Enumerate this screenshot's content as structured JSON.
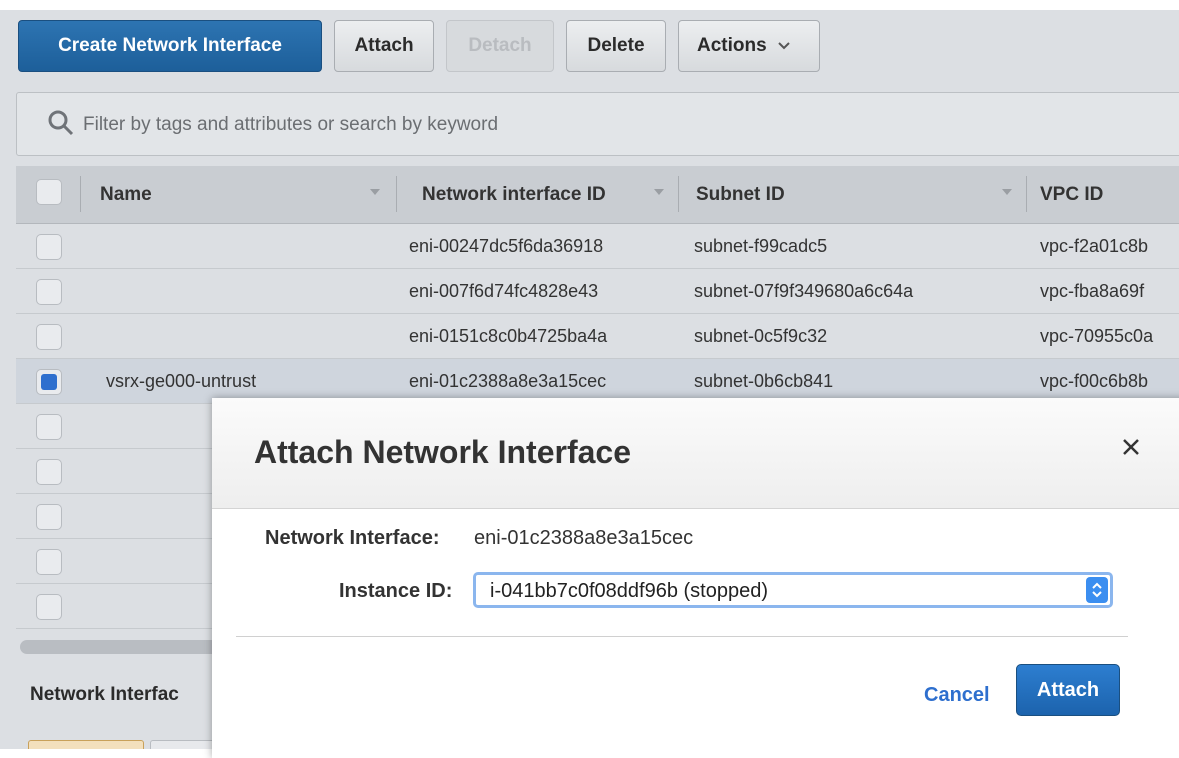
{
  "toolbar": {
    "create_label": "Create Network Interface",
    "attach_label": "Attach",
    "detach_label": "Detach",
    "delete_label": "Delete",
    "actions_label": "Actions"
  },
  "search": {
    "placeholder": "Filter by tags and attributes or search by keyword"
  },
  "table": {
    "columns": [
      "Name",
      "Network interface ID",
      "Subnet ID",
      "VPC ID"
    ],
    "rows": [
      {
        "name": "",
        "eni": "eni-00247dc5f6da36918",
        "subnet": "subnet-f99cadc5",
        "vpc": "vpc-f2a01c8b",
        "checked": false
      },
      {
        "name": "",
        "eni": "eni-007f6d74fc4828e43",
        "subnet": "subnet-07f9f349680a6c64a",
        "vpc": "vpc-fba8a69f",
        "checked": false
      },
      {
        "name": "",
        "eni": "eni-0151c8c0b4725ba4a",
        "subnet": "subnet-0c5f9c32",
        "vpc": "vpc-70955c0a",
        "checked": false
      },
      {
        "name": "vsrx-ge000-untrust",
        "eni": "eni-01c2388a8e3a15cec",
        "subnet": "subnet-0b6cb841",
        "vpc": "vpc-f00c6b8b",
        "checked": true
      }
    ]
  },
  "bottom": {
    "title": "Network Interfac"
  },
  "modal": {
    "title": "Attach Network Interface",
    "ni_label": "Network Interface:",
    "ni_value": "eni-01c2388a8e3a15cec",
    "instance_label": "Instance ID:",
    "instance_value": "i-041bb7c0f08ddf96b (stopped)",
    "cancel_label": "Cancel",
    "attach_label": "Attach"
  },
  "colors": {
    "primary": "#2d74b2",
    "link": "#2e6fce",
    "selection": "#3b8ef0"
  }
}
